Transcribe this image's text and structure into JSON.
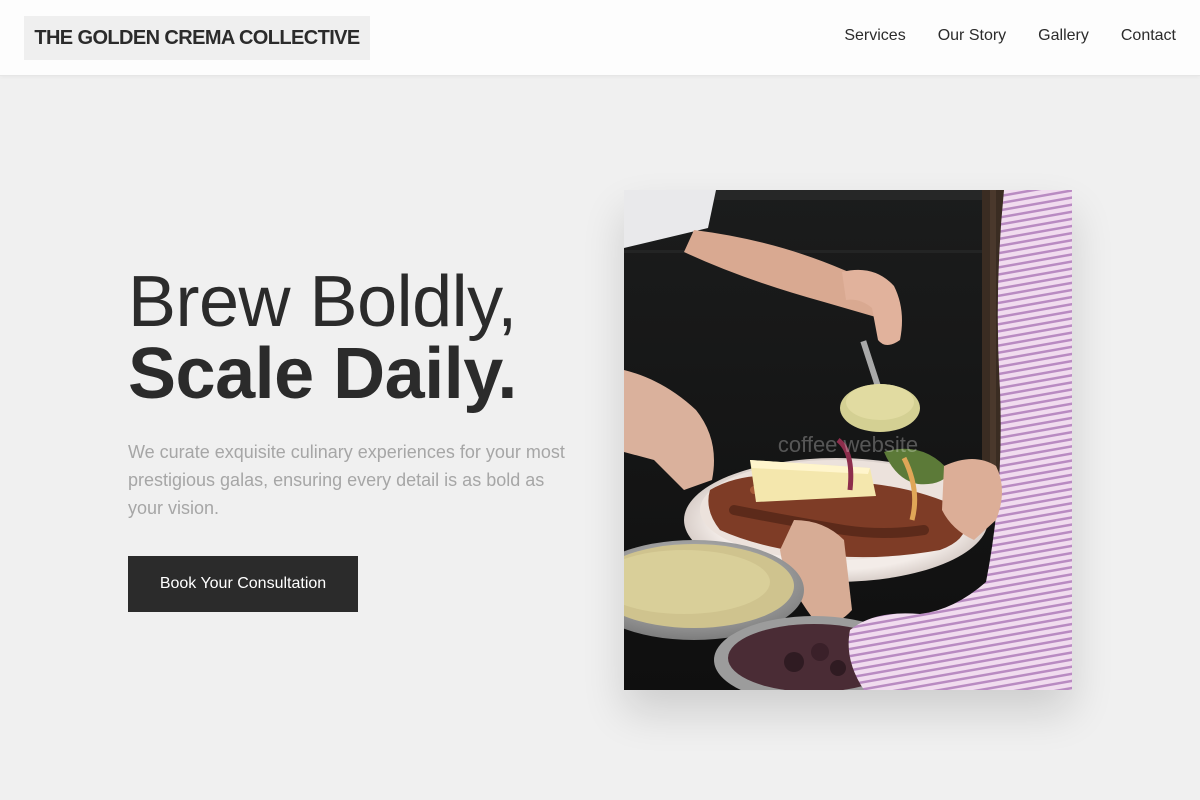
{
  "brand": {
    "name": "THE GOLDEN CREMA COLLECTIVE"
  },
  "nav": {
    "items": [
      {
        "label": "Services"
      },
      {
        "label": "Our Story"
      },
      {
        "label": "Gallery"
      },
      {
        "label": "Contact"
      }
    ]
  },
  "hero": {
    "headline_line1": "Brew Boldly,",
    "headline_line2": "Scale Daily.",
    "subtitle": "We curate exquisite culinary experiences for your most prestigious galas, ensuring every detail is as bold as your vision.",
    "cta_label": "Book Your Consultation",
    "image_watermark": "coffee website"
  },
  "colors": {
    "background": "#f0f0f0",
    "header_background": "#fdfdfd",
    "text_dark": "#2b2b2b",
    "subtitle_gray": "#a6a6a6",
    "button_background": "#2b2b2b",
    "button_text": "#ffffff"
  }
}
